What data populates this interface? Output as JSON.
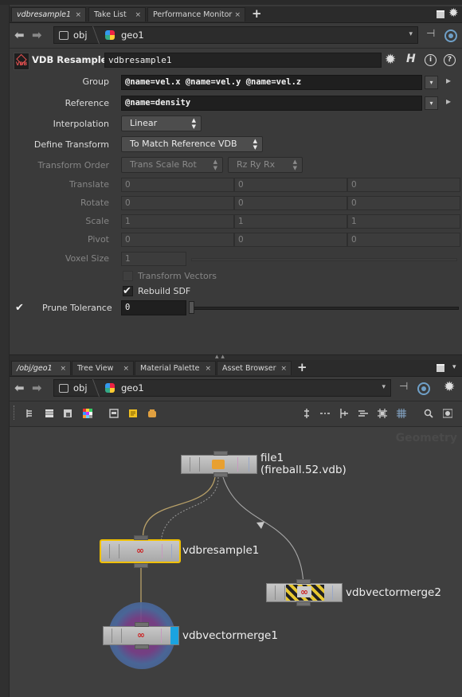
{
  "top_tabs": {
    "tabs": [
      {
        "label": "vdbresample1",
        "active": true
      },
      {
        "label": "Take List"
      },
      {
        "label": "Performance Monitor"
      }
    ],
    "close_glyph": "×",
    "add_glyph": "+"
  },
  "top_nav": {
    "back_glyph": "⬅",
    "forward_glyph": "➡",
    "path": [
      "obj",
      "geo1"
    ],
    "dropdown_glyph": "▾"
  },
  "parm_header": {
    "badge": "VDB",
    "node_type": "VDB Resample",
    "node_name": "vdbresample1",
    "gear_glyph": "✹",
    "help_h": "H",
    "info_glyph": "i",
    "question_glyph": "?"
  },
  "params": {
    "group": {
      "label": "Group",
      "value": "@name=vel.x @name=vel.y @name=vel.z"
    },
    "reference": {
      "label": "Reference",
      "value": "@name=density"
    },
    "interpolation": {
      "label": "Interpolation",
      "value": "Linear"
    },
    "define_transform": {
      "label": "Define Transform",
      "value": "To Match Reference VDB"
    },
    "transform_order": {
      "label": "Transform Order",
      "value": "Transform Order",
      "order": "Trans Scale Rot",
      "rot": "Rz Ry Rx"
    },
    "translate": {
      "label": "Translate",
      "values": [
        "0",
        "0",
        "0"
      ]
    },
    "rotate": {
      "label": "Rotate",
      "values": [
        "0",
        "0",
        "0"
      ]
    },
    "scale": {
      "label": "Scale",
      "values": [
        "1",
        "1",
        "1"
      ]
    },
    "pivot": {
      "label": "Pivot",
      "values": [
        "0",
        "0",
        "0"
      ]
    },
    "voxel_size": {
      "label": "Voxel Size",
      "value": "1"
    },
    "transform_vectors": {
      "label": "Transform Vectors",
      "checked": false
    },
    "rebuild_sdf": {
      "label": "Rebuild SDF",
      "checked": true
    },
    "prune_tolerance": {
      "label": "Prune Tolerance",
      "value": "0",
      "enabled": true
    },
    "check_glyph": "✔",
    "arrow_glyph": "▸"
  },
  "net_tabs": {
    "tabs": [
      {
        "label": "/obj/geo1",
        "active": true
      },
      {
        "label": "Tree View"
      },
      {
        "label": "Material Palette"
      },
      {
        "label": "Asset Browser"
      }
    ]
  },
  "net_nav": {
    "path": [
      "obj",
      "geo1"
    ]
  },
  "network": {
    "context_label": "Geometry",
    "nodes": [
      {
        "id": "file1",
        "label": "file1",
        "sublabel": "(fireball.52.vdb)"
      },
      {
        "id": "vdbresample1",
        "label": "vdbresample1",
        "selected": true
      },
      {
        "id": "vdbvectormerge2",
        "label": "vdbvectormerge2",
        "bypassed": true
      },
      {
        "id": "vdbvectormerge1",
        "label": "vdbvectormerge1",
        "display": true
      }
    ],
    "colors": {
      "selected": "#f0c000",
      "display": "#1aa3e0",
      "bypass": "#e8c830",
      "wire": "#b8a068"
    }
  }
}
